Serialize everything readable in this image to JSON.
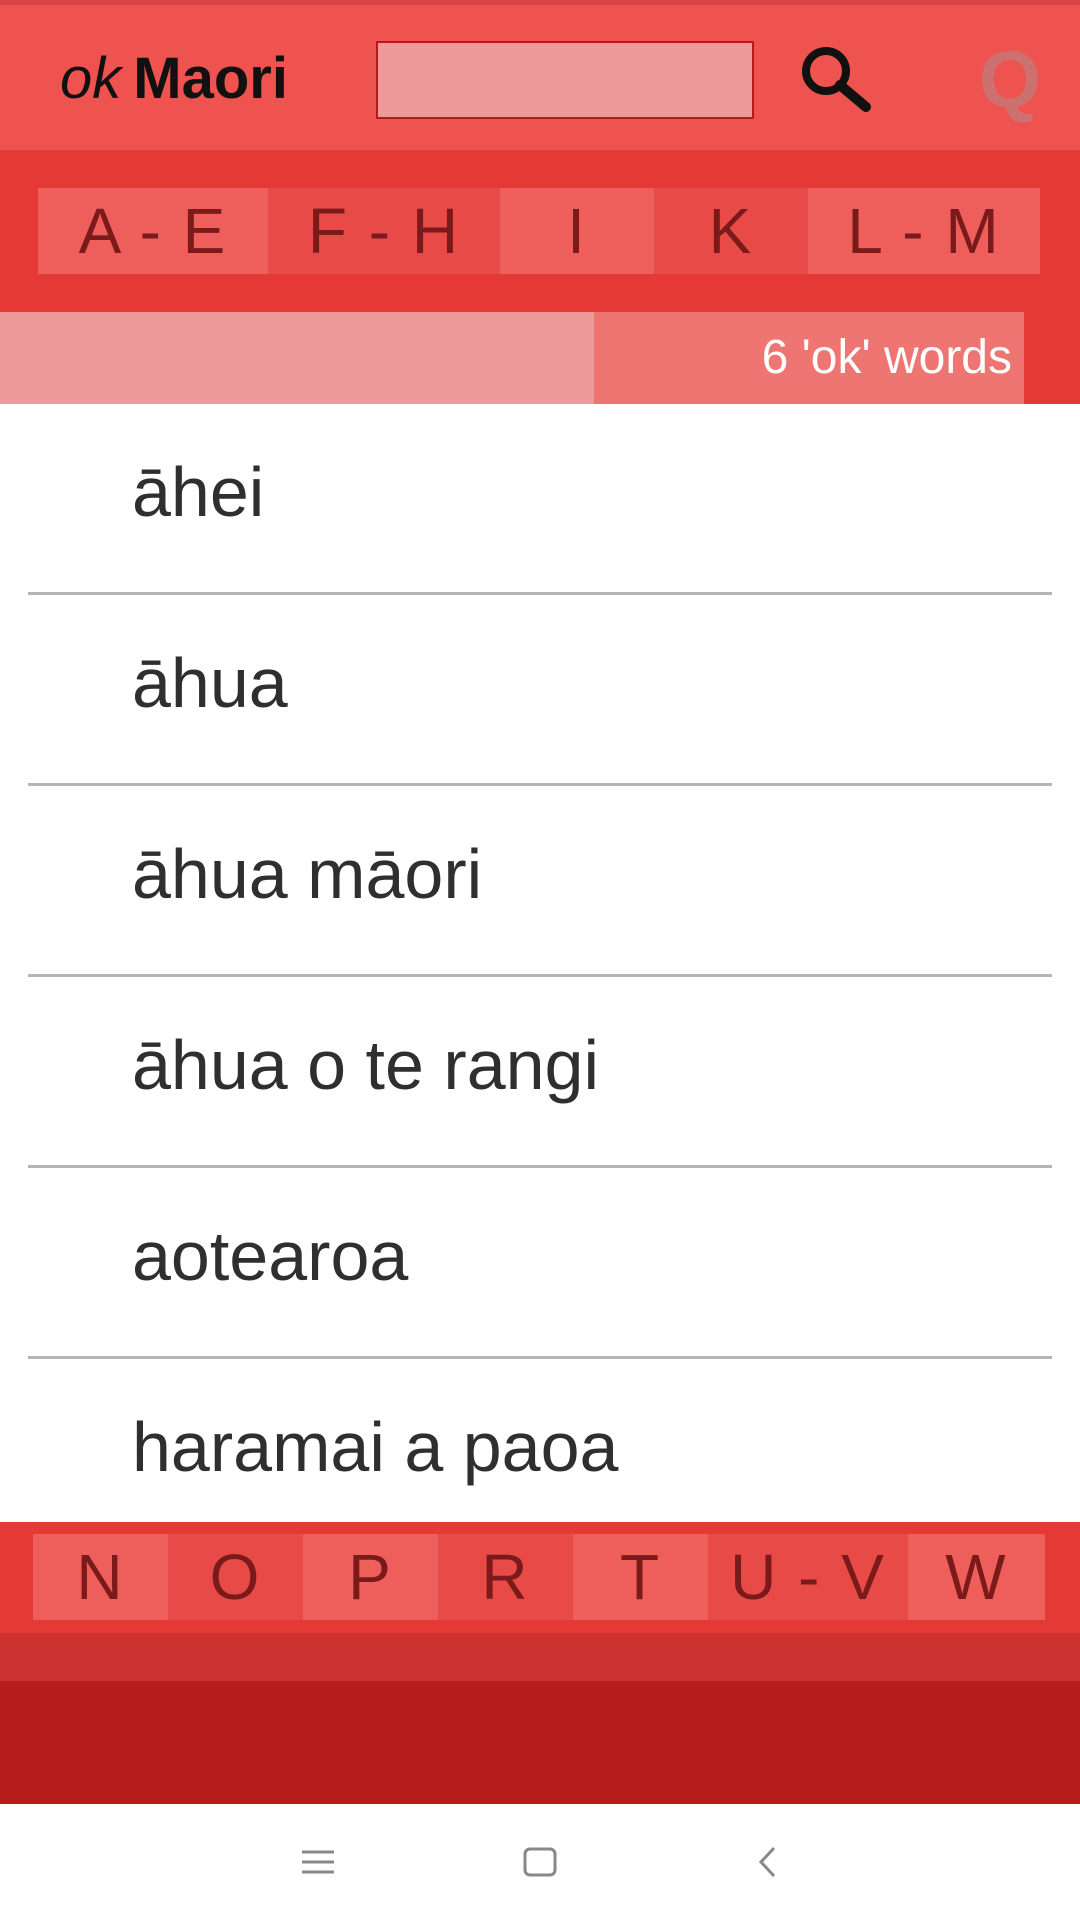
{
  "header": {
    "logo_ok": "ok",
    "logo_maori": "Maori",
    "search_value": "",
    "q_label": "Q"
  },
  "alphabet_top": [
    {
      "label": "A - E"
    },
    {
      "label": "F - H"
    },
    {
      "label": "I"
    },
    {
      "label": "K"
    },
    {
      "label": "L - M"
    }
  ],
  "count": {
    "label": "6 'ok' words"
  },
  "words": [
    {
      "text": "āhei"
    },
    {
      "text": "āhua"
    },
    {
      "text": "āhua māori"
    },
    {
      "text": "āhua o te rangi"
    },
    {
      "text": "aotearoa"
    },
    {
      "text": "haramai a paoa"
    }
  ],
  "alphabet_bottom": [
    {
      "label": "N"
    },
    {
      "label": "O"
    },
    {
      "label": "P"
    },
    {
      "label": "R"
    },
    {
      "label": "T"
    },
    {
      "label": "U - V"
    },
    {
      "label": "W"
    }
  ],
  "navbar": {
    "icons": [
      "menu-icon",
      "home-square-icon",
      "back-chevron-icon"
    ]
  },
  "colors": {
    "header": "#ef5350",
    "alphabet_bar": "#e53935",
    "letter_text": "#7a1a1a",
    "count_bar": "#ef9a9a",
    "count_box": "#ee7572",
    "dark_footer": "#b71c1c"
  }
}
